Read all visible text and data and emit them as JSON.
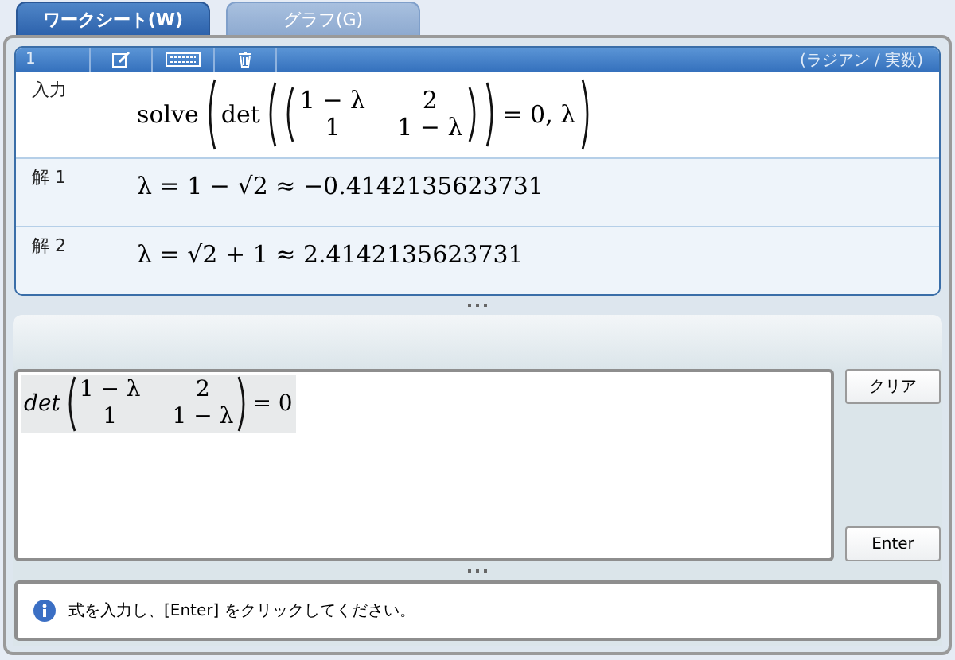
{
  "tabs": [
    {
      "label": "ワークシート(W)",
      "selected": true
    },
    {
      "label": "グラフ(G)",
      "selected": false
    }
  ],
  "worksheet": {
    "toolbar": {
      "number": "1",
      "mode": "(ラジアン / 実数)"
    },
    "entries": [
      {
        "kind": "input",
        "label": "入力",
        "func": "solve",
        "op": "det",
        "matrix": [
          [
            "1 − λ",
            "2"
          ],
          [
            "1",
            "1 − λ"
          ]
        ],
        "tail": "= 0, λ"
      },
      {
        "kind": "solution",
        "label": "解 1",
        "expression": "λ = 1 − √2 ≈ −0.4142135623731"
      },
      {
        "kind": "solution",
        "label": "解 2",
        "expression": "λ = √2 + 1 ≈ 2.4142135623731"
      }
    ]
  },
  "editor": {
    "op": "det",
    "matrix": [
      [
        "1 − λ",
        "2"
      ],
      [
        "1",
        "1 − λ"
      ]
    ],
    "tail": "= 0"
  },
  "buttons": {
    "clear": "クリア",
    "enter": "Enter"
  },
  "status": {
    "message": "式を入力し、[Enter] をクリックしてください。"
  }
}
